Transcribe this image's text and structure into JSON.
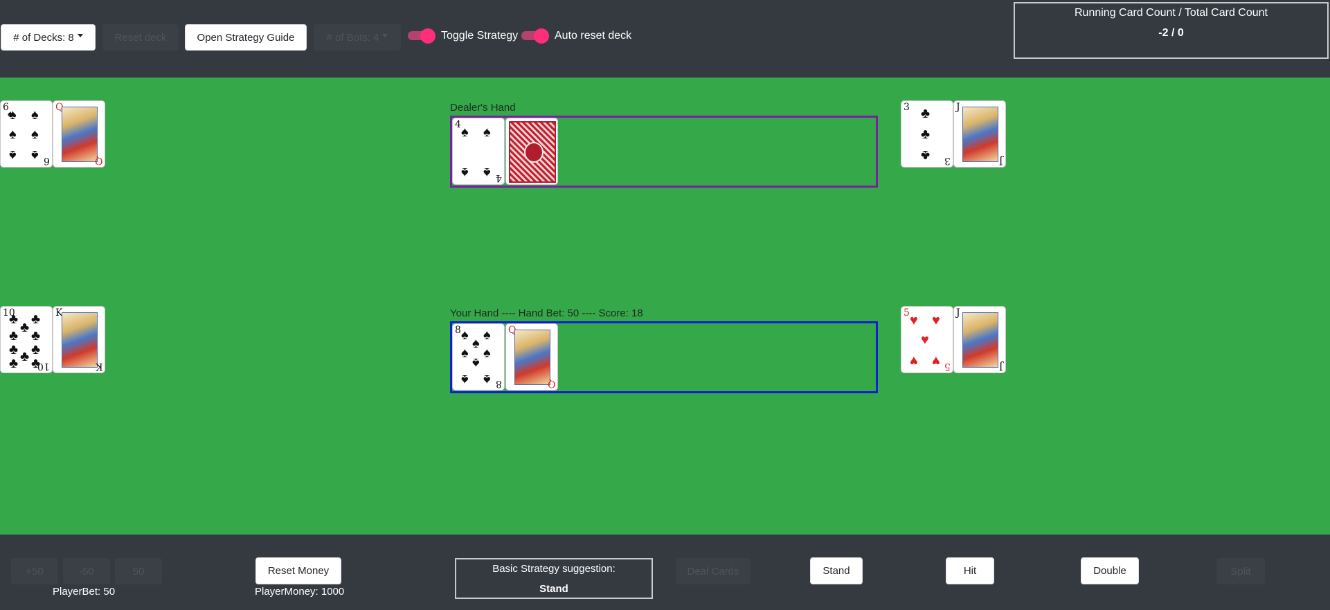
{
  "toolbar": {
    "decks_label": "# of Decks: 8",
    "reset_deck_label": "Reset deck",
    "strategy_guide_label": "Open Strategy Guide",
    "bots_label": "# of Bots: 4",
    "toggle_strategy_label": "Toggle Strategy",
    "auto_reset_label": "Auto reset deck"
  },
  "count": {
    "title": "Running Card Count / Total Card Count",
    "value": "-2 / 0"
  },
  "dealer": {
    "label": "Dealer's Hand",
    "cards": [
      {
        "rank": "4",
        "suit": "spades"
      },
      {
        "rank": "",
        "suit": "hidden"
      }
    ]
  },
  "player": {
    "label": "Your Hand ---- Hand Bet: 50 ---- Score: 18",
    "cards": [
      {
        "rank": "8",
        "suit": "spades"
      },
      {
        "rank": "Q",
        "suit": "hearts"
      }
    ]
  },
  "bots": [
    {
      "position": "top-left",
      "cards": [
        {
          "rank": "6",
          "suit": "spades"
        },
        {
          "rank": "Q",
          "suit": "hearts"
        }
      ]
    },
    {
      "position": "top-right",
      "cards": [
        {
          "rank": "3",
          "suit": "clubs"
        },
        {
          "rank": "J",
          "suit": "clubs"
        }
      ]
    },
    {
      "position": "bottom-left",
      "cards": [
        {
          "rank": "10",
          "suit": "clubs"
        },
        {
          "rank": "K",
          "suit": "clubs"
        }
      ]
    },
    {
      "position": "bottom-right",
      "cards": [
        {
          "rank": "5",
          "suit": "hearts"
        },
        {
          "rank": "J",
          "suit": "spades"
        }
      ]
    }
  ],
  "bottom": {
    "bet_plus_label": "+50",
    "bet_minus_label": "-50",
    "bet_set_label": "50",
    "player_bet": "PlayerBet: 50",
    "reset_money_label": "Reset Money",
    "player_money": "PlayerMoney: 1000",
    "strategy_title": "Basic Strategy suggestion:",
    "strategy_value": "Stand",
    "deal_label": "Deal Cards",
    "stand_label": "Stand",
    "hit_label": "Hit",
    "double_label": "Double",
    "split_label": "Split"
  },
  "colors": {
    "table": "#35a84a",
    "bar": "#343a40",
    "dealer_border": "#7b1fa2",
    "player_border": "#1020d0",
    "toggle": "#ff2e7a"
  }
}
